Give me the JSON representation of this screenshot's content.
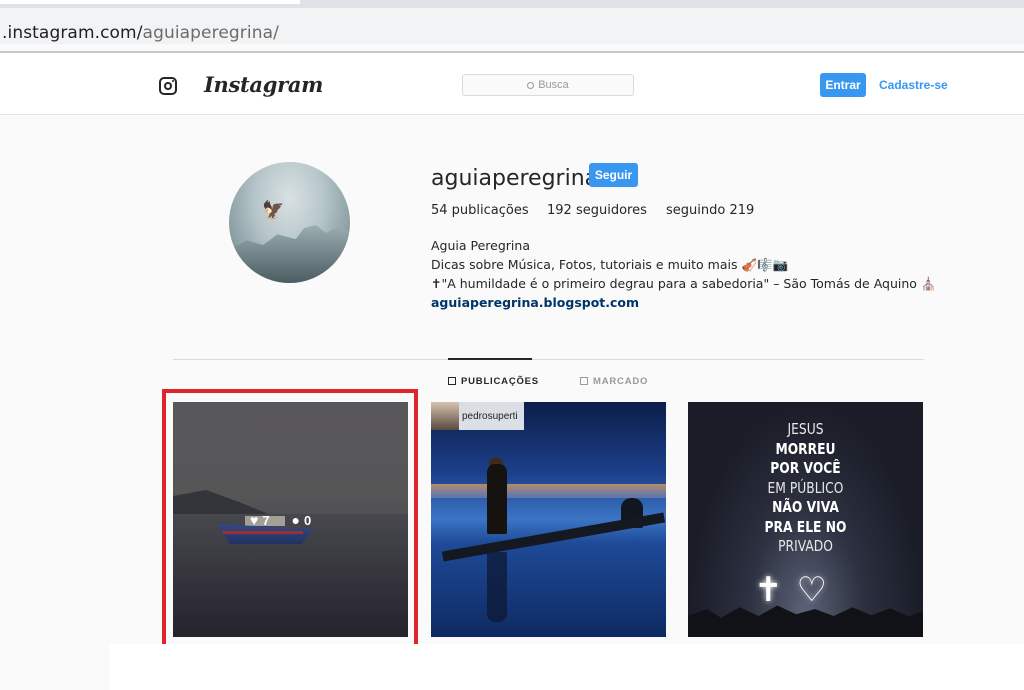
{
  "browser": {
    "url_host": ".instagram.com/",
    "url_path": "aguiaperegrina/"
  },
  "header": {
    "logo_text": "Instagram",
    "search_placeholder": "Busca",
    "login_label": "Entrar",
    "signup_label": "Cadastre-se"
  },
  "profile": {
    "username": "aguiaperegrina",
    "follow_label": "Seguir",
    "stats": {
      "posts": "54 publicações",
      "followers": "192 seguidores",
      "following": "seguindo 219"
    },
    "bio": {
      "name": "Aguia Peregrina",
      "line1": "Dicas sobre Música, Fotos, tutoriais e muito mais 🎻🎼📷",
      "line2": "✝\"A humildade é o primeiro degrau para a sabedoria\" – São Tomás de Aquino ⛪",
      "link": "aguiaperegrina.blogspot.com"
    }
  },
  "tabs": {
    "publications": "PUBLICAÇÕES",
    "tagged": "MARCADO"
  },
  "posts": [
    {
      "likes": "7",
      "comments": "0"
    },
    {
      "credit": "pedrosuperti"
    },
    {
      "lines": [
        "JESUS",
        "MORREU",
        "POR VOCÊ",
        "EM PÚBLICO",
        "NÃO VIVA",
        "PRA ELE NO",
        "PRIVADO"
      ]
    }
  ],
  "colors": {
    "accent": "#3897f0",
    "highlight": "#e0242b"
  }
}
